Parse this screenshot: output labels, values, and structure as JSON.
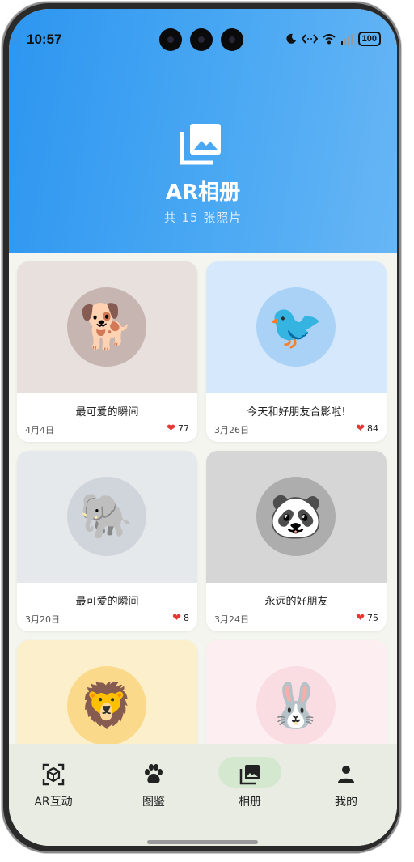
{
  "status_bar": {
    "time": "10:57",
    "icons": [
      "moon-icon",
      "data-arrows-icon",
      "wifi-icon",
      "signal-icon"
    ],
    "battery": "100"
  },
  "header": {
    "icon": "photo-album-icon",
    "title": "AR相册",
    "subtitle": "共 15 张照片"
  },
  "photos": [
    {
      "emoji": "🐕",
      "animal": "dog",
      "bg": "#e8e0dd",
      "circle": "#c6b5b0",
      "caption": "最可爱的瞬间",
      "date": "4月4日",
      "likes": "77"
    },
    {
      "emoji": "🐦",
      "animal": "bird",
      "bg": "#d6e8fb",
      "circle": "#a9d2f6",
      "caption": "今天和好朋友合影啦!",
      "date": "3月26日",
      "likes": "84"
    },
    {
      "emoji": "🐘",
      "animal": "elephant",
      "bg": "#e6e9ec",
      "circle": "#cfd5da",
      "caption": "最可爱的瞬间",
      "date": "3月20日",
      "likes": "8"
    },
    {
      "emoji": "🐼",
      "animal": "panda",
      "bg": "#d6d6d6",
      "circle": "#adadad",
      "caption": "永远的好朋友",
      "date": "3月24日",
      "likes": "75"
    },
    {
      "emoji": "🦁",
      "animal": "lion",
      "bg": "#fcefcc",
      "circle": "#fbd98a",
      "caption": "",
      "date": "",
      "likes": ""
    },
    {
      "emoji": "🐰",
      "animal": "rabbit",
      "bg": "#fdeff1",
      "circle": "#f9dde2",
      "caption": "",
      "date": "",
      "likes": ""
    }
  ],
  "tabs": [
    {
      "label": "AR互动",
      "icon": "ar-cube-icon",
      "active": false
    },
    {
      "label": "图鉴",
      "icon": "paw-icon",
      "active": false
    },
    {
      "label": "相册",
      "icon": "album-icon",
      "active": true
    },
    {
      "label": "我的",
      "icon": "person-icon",
      "active": false
    }
  ],
  "colors": {
    "header_gradient_start": "#2d96f0",
    "header_gradient_end": "#67b6f5",
    "active_tab_pill": "#d3e8cf",
    "like_heart": "#e53935"
  }
}
